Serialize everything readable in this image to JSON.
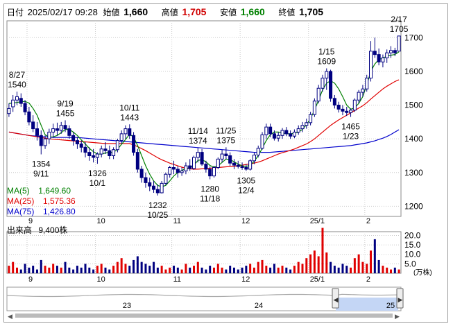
{
  "header": {
    "date_label": "日付",
    "datetime": "2025/02/17 09:28",
    "open_label": "始値",
    "open": "1,660",
    "high_label": "高値",
    "high": "1,705",
    "low_label": "安値",
    "low": "1,660",
    "close_label": "終値",
    "close": "1,705"
  },
  "colors": {
    "ma5": "#008000",
    "ma25": "#e00000",
    "ma75": "#0000cc",
    "candle": "#000080",
    "volume_up": "#e00000",
    "volume_down": "#000080",
    "accent_high": "#d00000",
    "accent_low": "#008000"
  },
  "legend": [
    {
      "name": "MA(5)",
      "value": "1,649.60",
      "color": "#008000"
    },
    {
      "name": "MA(25)",
      "value": "1,575.36",
      "color": "#e00000"
    },
    {
      "name": "MA(75)",
      "value": "1,426.80",
      "color": "#0000cc"
    }
  ],
  "volume_label": "出来高",
  "volume_value": "9,400株",
  "volume_unit": "(万株)",
  "navigator_labels": [
    "23",
    "24",
    "25"
  ],
  "chart_data": [
    {
      "type": "candlestick",
      "title": "",
      "ylim": [
        1170,
        1750
      ],
      "y_ticks": [
        1200,
        1300,
        1400,
        1500,
        1600,
        1700
      ],
      "x_ticks": [
        "9",
        "10",
        "11",
        "12",
        "25/1",
        "2"
      ],
      "x_tick_index": [
        5,
        22,
        41,
        58,
        75,
        89
      ],
      "grid": true,
      "annotations": [
        {
          "text": [
            "8/27",
            "1540"
          ],
          "index": 2,
          "value": 1540,
          "place": "above"
        },
        {
          "text": [
            "9/19",
            "1455"
          ],
          "index": 14,
          "value": 1455,
          "place": "above"
        },
        {
          "text": [
            "10/11",
            "1443"
          ],
          "index": 30,
          "value": 1443,
          "place": "above"
        },
        {
          "text": [
            "11/14",
            "1374"
          ],
          "index": 47,
          "value": 1374,
          "place": "above"
        },
        {
          "text": [
            "11/25",
            "1375"
          ],
          "index": 54,
          "value": 1375,
          "place": "above"
        },
        {
          "text": [
            "1/15",
            "1609"
          ],
          "index": 79,
          "value": 1609,
          "place": "above"
        },
        {
          "text": [
            "2/17",
            "1705"
          ],
          "index": 97,
          "value": 1705,
          "place": "above"
        },
        {
          "text": [
            "1354",
            "9/11"
          ],
          "index": 8,
          "value": 1354,
          "place": "below"
        },
        {
          "text": [
            "1326",
            "10/1"
          ],
          "index": 22,
          "value": 1326,
          "place": "below"
        },
        {
          "text": [
            "1232",
            "10/25"
          ],
          "index": 37,
          "value": 1232,
          "place": "below"
        },
        {
          "text": [
            "1280",
            "11/18"
          ],
          "index": 50,
          "value": 1280,
          "place": "below"
        },
        {
          "text": [
            "1305",
            "12/4"
          ],
          "index": 59,
          "value": 1305,
          "place": "below"
        },
        {
          "text": [
            "1465",
            "1/23"
          ],
          "index": 85,
          "value": 1465,
          "place": "below"
        }
      ],
      "ohlc": [
        [
          1475,
          1505,
          1465,
          1490
        ],
        [
          1495,
          1530,
          1480,
          1515
        ],
        [
          1515,
          1540,
          1500,
          1525
        ],
        [
          1520,
          1535,
          1495,
          1505
        ],
        [
          1505,
          1515,
          1470,
          1480
        ],
        [
          1480,
          1495,
          1440,
          1450
        ],
        [
          1450,
          1470,
          1420,
          1430
        ],
        [
          1430,
          1450,
          1395,
          1410
        ],
        [
          1410,
          1425,
          1354,
          1380
        ],
        [
          1380,
          1410,
          1370,
          1400
        ],
        [
          1400,
          1430,
          1385,
          1420
        ],
        [
          1420,
          1445,
          1405,
          1430
        ],
        [
          1430,
          1448,
          1410,
          1425
        ],
        [
          1425,
          1450,
          1415,
          1440
        ],
        [
          1440,
          1455,
          1420,
          1430
        ],
        [
          1430,
          1440,
          1400,
          1410
        ],
        [
          1410,
          1420,
          1380,
          1395
        ],
        [
          1395,
          1405,
          1370,
          1385
        ],
        [
          1385,
          1395,
          1360,
          1375
        ],
        [
          1375,
          1390,
          1345,
          1360
        ],
        [
          1360,
          1375,
          1335,
          1350
        ],
        [
          1350,
          1370,
          1330,
          1345
        ],
        [
          1345,
          1360,
          1326,
          1355
        ],
        [
          1355,
          1380,
          1345,
          1370
        ],
        [
          1370,
          1390,
          1355,
          1365
        ],
        [
          1365,
          1380,
          1340,
          1350
        ],
        [
          1350,
          1375,
          1340,
          1368
        ],
        [
          1368,
          1400,
          1360,
          1395
        ],
        [
          1395,
          1425,
          1385,
          1415
        ],
        [
          1415,
          1440,
          1400,
          1430
        ],
        [
          1430,
          1443,
          1400,
          1410
        ],
        [
          1410,
          1420,
          1350,
          1360
        ],
        [
          1360,
          1370,
          1300,
          1310
        ],
        [
          1310,
          1320,
          1270,
          1285
        ],
        [
          1285,
          1300,
          1255,
          1270
        ],
        [
          1270,
          1285,
          1245,
          1260
        ],
        [
          1260,
          1275,
          1240,
          1250
        ],
        [
          1250,
          1265,
          1232,
          1240
        ],
        [
          1240,
          1275,
          1238,
          1268
        ],
        [
          1268,
          1300,
          1262,
          1295
        ],
        [
          1295,
          1320,
          1285,
          1315
        ],
        [
          1315,
          1335,
          1295,
          1310
        ],
        [
          1310,
          1320,
          1285,
          1300
        ],
        [
          1300,
          1315,
          1290,
          1305
        ],
        [
          1305,
          1330,
          1295,
          1320
        ],
        [
          1320,
          1340,
          1305,
          1312
        ],
        [
          1312,
          1350,
          1308,
          1345
        ],
        [
          1345,
          1374,
          1330,
          1360
        ],
        [
          1360,
          1370,
          1320,
          1325
        ],
        [
          1325,
          1335,
          1300,
          1310
        ],
        [
          1310,
          1318,
          1280,
          1290
        ],
        [
          1290,
          1320,
          1285,
          1315
        ],
        [
          1315,
          1345,
          1310,
          1340
        ],
        [
          1340,
          1368,
          1330,
          1355
        ],
        [
          1355,
          1375,
          1340,
          1350
        ],
        [
          1350,
          1360,
          1320,
          1328
        ],
        [
          1328,
          1340,
          1310,
          1322
        ],
        [
          1322,
          1335,
          1312,
          1318
        ],
        [
          1318,
          1330,
          1308,
          1315
        ],
        [
          1315,
          1325,
          1305,
          1310
        ],
        [
          1310,
          1340,
          1306,
          1335
        ],
        [
          1335,
          1360,
          1325,
          1352
        ],
        [
          1352,
          1380,
          1345,
          1372
        ],
        [
          1372,
          1420,
          1368,
          1412
        ],
        [
          1412,
          1445,
          1400,
          1435
        ],
        [
          1435,
          1445,
          1405,
          1415
        ],
        [
          1415,
          1425,
          1395,
          1402
        ],
        [
          1402,
          1420,
          1392,
          1410
        ],
        [
          1410,
          1432,
          1400,
          1425
        ],
        [
          1425,
          1435,
          1408,
          1415
        ],
        [
          1415,
          1425,
          1400,
          1408
        ],
        [
          1408,
          1428,
          1402,
          1420
        ],
        [
          1420,
          1440,
          1412,
          1430
        ],
        [
          1430,
          1450,
          1420,
          1440
        ],
        [
          1440,
          1460,
          1430,
          1448
        ],
        [
          1448,
          1480,
          1440,
          1472
        ],
        [
          1472,
          1520,
          1465,
          1512
        ],
        [
          1512,
          1560,
          1505,
          1550
        ],
        [
          1550,
          1590,
          1540,
          1580
        ],
        [
          1580,
          1609,
          1545,
          1600
        ],
        [
          1600,
          1605,
          1510,
          1520
        ],
        [
          1520,
          1530,
          1490,
          1500
        ],
        [
          1500,
          1510,
          1478,
          1488
        ],
        [
          1488,
          1500,
          1470,
          1482
        ],
        [
          1482,
          1495,
          1468,
          1478
        ],
        [
          1478,
          1490,
          1465,
          1485
        ],
        [
          1485,
          1520,
          1480,
          1515
        ],
        [
          1515,
          1545,
          1505,
          1538
        ],
        [
          1538,
          1560,
          1525,
          1548
        ],
        [
          1548,
          1590,
          1540,
          1580
        ],
        [
          1580,
          1690,
          1570,
          1660
        ],
        [
          1660,
          1700,
          1640,
          1650
        ],
        [
          1650,
          1668,
          1618,
          1628
        ],
        [
          1628,
          1650,
          1612,
          1640
        ],
        [
          1640,
          1665,
          1625,
          1655
        ],
        [
          1655,
          1675,
          1640,
          1662
        ],
        [
          1662,
          1670,
          1645,
          1655
        ],
        [
          1660,
          1705,
          1660,
          1705
        ]
      ],
      "ma5": [
        1505,
        1506,
        1508,
        1510,
        1511,
        1506,
        1490,
        1470,
        1440,
        1412,
        1405,
        1406,
        1410,
        1418,
        1428,
        1428,
        1420,
        1410,
        1397,
        1385,
        1372,
        1362,
        1355,
        1355,
        1358,
        1360,
        1360,
        1369,
        1384,
        1398,
        1414,
        1405,
        1380,
        1350,
        1320,
        1295,
        1275,
        1262,
        1258,
        1262,
        1275,
        1290,
        1300,
        1306,
        1313,
        1313,
        1322,
        1336,
        1338,
        1332,
        1321,
        1316,
        1320,
        1330,
        1340,
        1338,
        1332,
        1325,
        1320,
        1318,
        1322,
        1333,
        1350,
        1372,
        1395,
        1412,
        1420,
        1420,
        1418,
        1415,
        1415,
        1416,
        1420,
        1428,
        1442,
        1460,
        1485,
        1515,
        1545,
        1565,
        1572,
        1565,
        1548,
        1525,
        1500,
        1488,
        1492,
        1505,
        1525,
        1560,
        1600,
        1622,
        1635,
        1640,
        1645,
        1648,
        1650,
        1658
      ],
      "ma25": [
        1420,
        1418,
        1416,
        1414,
        1412,
        1410,
        1408,
        1406,
        1404,
        1402,
        1400,
        1399,
        1398,
        1397,
        1396,
        1395,
        1394,
        1393,
        1392,
        1391,
        1390,
        1389,
        1388,
        1387,
        1386,
        1386,
        1386,
        1386,
        1386,
        1386,
        1386,
        1382,
        1377,
        1371,
        1365,
        1358,
        1351,
        1344,
        1338,
        1333,
        1328,
        1324,
        1320,
        1316,
        1313,
        1311,
        1310,
        1310,
        1311,
        1312,
        1313,
        1314,
        1315,
        1316,
        1317,
        1318,
        1319,
        1320,
        1322,
        1324,
        1326,
        1328,
        1331,
        1335,
        1340,
        1345,
        1350,
        1355,
        1359,
        1362,
        1366,
        1370,
        1375,
        1380,
        1385,
        1392,
        1400,
        1410,
        1420,
        1430,
        1440,
        1448,
        1456,
        1463,
        1470,
        1477,
        1484,
        1491,
        1498,
        1507,
        1518,
        1528,
        1538,
        1548,
        1556,
        1563,
        1570,
        1575
      ],
      "ma75": [
        1420,
        1418,
        1416,
        1414,
        1412,
        1410,
        1409,
        1408,
        1407,
        1406,
        1405,
        1404,
        1404,
        1404,
        1404,
        1404,
        1404,
        1404,
        1403,
        1402,
        1401,
        1400,
        1399,
        1398,
        1397,
        1396,
        1395,
        1394,
        1393,
        1392,
        1391,
        1390,
        1389,
        1388,
        1387,
        1386,
        1385,
        1384,
        1383,
        1382,
        1381,
        1380,
        1379,
        1378,
        1377,
        1376,
        1375,
        1374,
        1373,
        1372,
        1371,
        1370,
        1369,
        1368,
        1367,
        1366,
        1365,
        1364,
        1363,
        1362,
        1361,
        1360,
        1360,
        1360,
        1360,
        1360,
        1361,
        1362,
        1363,
        1364,
        1365,
        1366,
        1367,
        1368,
        1369,
        1370,
        1371,
        1372,
        1373,
        1374,
        1375,
        1376,
        1377,
        1378,
        1379,
        1380,
        1382,
        1384,
        1386,
        1388,
        1391,
        1394,
        1398,
        1402,
        1407,
        1413,
        1420,
        1427
      ]
    },
    {
      "type": "bar",
      "title": "出来高",
      "unit": "(万株)",
      "ylim": [
        0,
        22
      ],
      "y_ticks": [
        "20.0",
        "15.0",
        "10.0",
        "5.0"
      ],
      "y_tick_values": [
        20,
        15,
        10,
        5
      ],
      "x_ticks": [
        "9",
        "10",
        "11",
        "12",
        "25/1",
        "2"
      ],
      "values": [
        4,
        6,
        3,
        2,
        5,
        3,
        4,
        2,
        7,
        4,
        3,
        5,
        4,
        3,
        6,
        3,
        2,
        4,
        3,
        5,
        3,
        2,
        4,
        5,
        3,
        2,
        4,
        6,
        8,
        5,
        4,
        7,
        9,
        6,
        5,
        4,
        6,
        3,
        4,
        2,
        3,
        4,
        3,
        2,
        5,
        3,
        4,
        6,
        3,
        2,
        4,
        3,
        5,
        3,
        2,
        4,
        3,
        2,
        3,
        4,
        5,
        3,
        6,
        7,
        4,
        3,
        5,
        3,
        4,
        3,
        2,
        4,
        6,
        5,
        8,
        10,
        12,
        9,
        24,
        11,
        6,
        4,
        3,
        5,
        4,
        3,
        8,
        10,
        6,
        5,
        12,
        18,
        7,
        4,
        3,
        2,
        3,
        2
      ],
      "up": [
        1,
        1,
        1,
        0,
        0,
        0,
        0,
        0,
        0,
        1,
        1,
        1,
        0,
        1,
        0,
        0,
        0,
        0,
        0,
        0,
        0,
        0,
        1,
        1,
        0,
        0,
        1,
        1,
        1,
        1,
        0,
        0,
        0,
        0,
        0,
        0,
        0,
        0,
        1,
        1,
        1,
        0,
        0,
        1,
        1,
        0,
        1,
        1,
        0,
        0,
        0,
        1,
        1,
        1,
        0,
        0,
        0,
        0,
        0,
        0,
        1,
        1,
        1,
        1,
        1,
        0,
        0,
        1,
        1,
        0,
        0,
        1,
        1,
        1,
        1,
        1,
        1,
        1,
        1,
        1,
        0,
        0,
        0,
        0,
        0,
        1,
        1,
        1,
        1,
        1,
        1,
        0,
        0,
        1,
        1,
        1,
        0,
        1
      ]
    }
  ]
}
